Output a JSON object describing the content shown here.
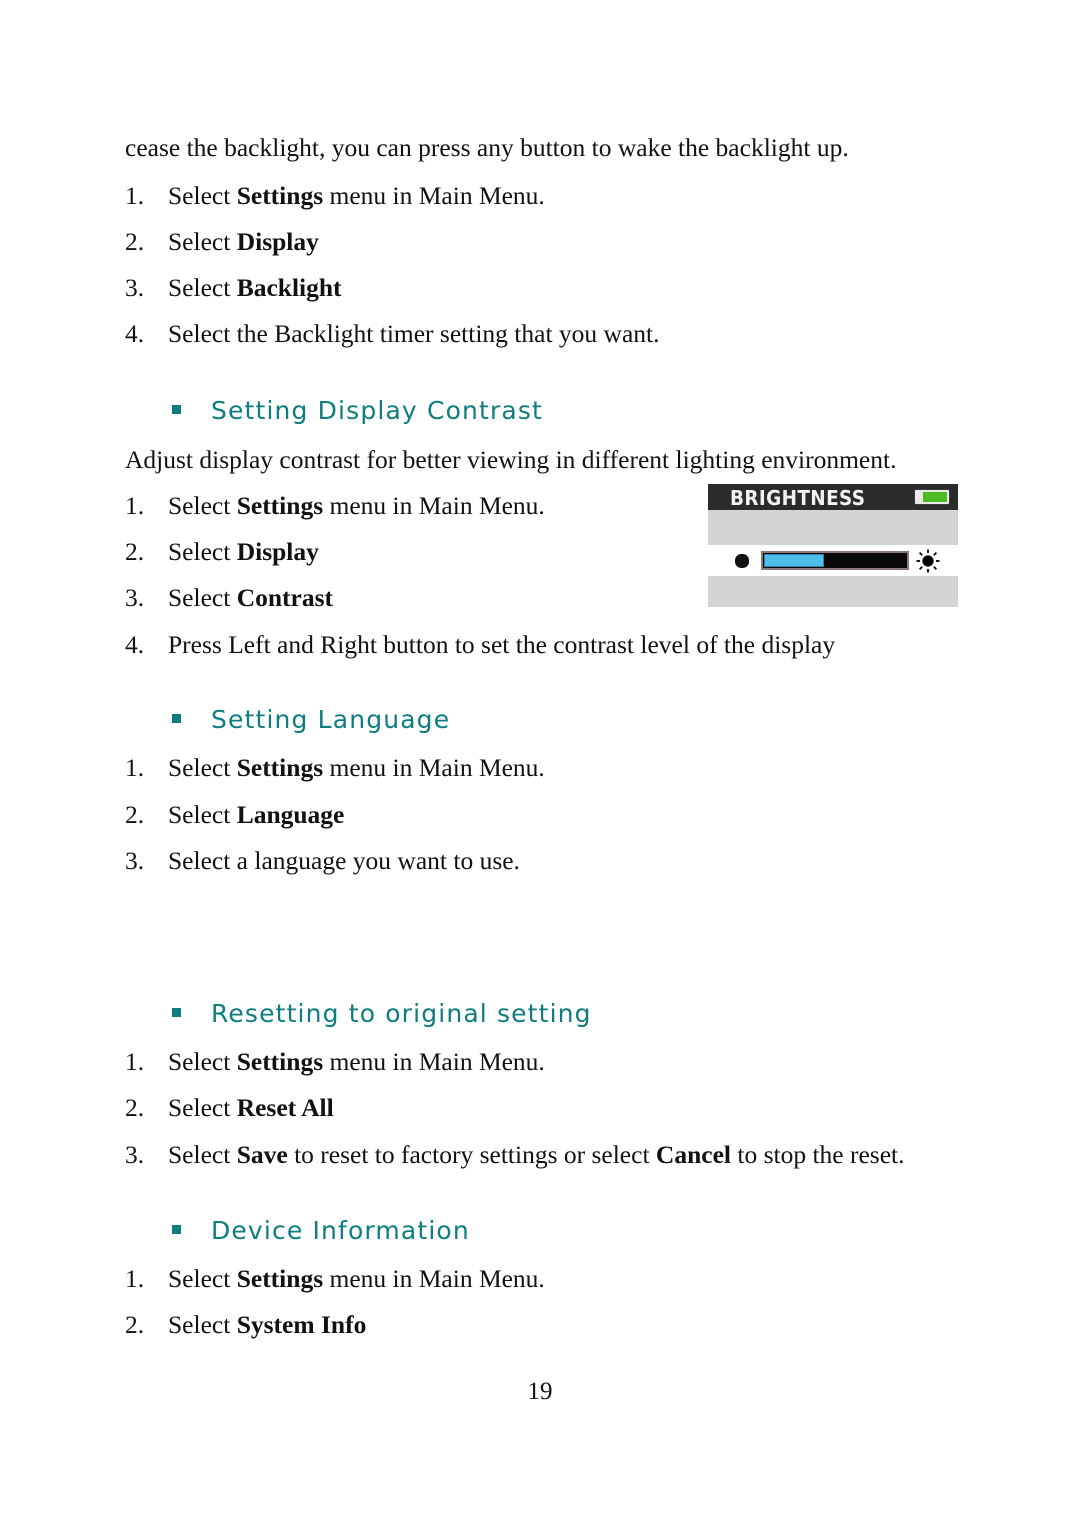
{
  "document": {
    "page_number": "19",
    "intro_line": "cease the backlight, you can press any button to wake the backlight up."
  },
  "theme": {
    "heading_color": "#0d7d7f",
    "body_color": "#111111",
    "device_titlebar_bg": "#2b2b2b",
    "device_body_bg": "#d4d4d4",
    "battery_fill": "#4cbb21",
    "contrast_fill": "#4ebfe8"
  },
  "sections": [
    {
      "id": "backlight-steps",
      "heading": null,
      "steps": [
        {
          "num": "1.",
          "pre": "Select ",
          "bold": "Settings",
          "post": " menu in Main Menu."
        },
        {
          "num": "2.",
          "pre": "Select ",
          "bold": "Display",
          "post": ""
        },
        {
          "num": "3.",
          "pre": "Select ",
          "bold": "Backlight",
          "post": ""
        },
        {
          "num": "4.",
          "pre": "Select the Backlight timer setting that you want.",
          "bold": "",
          "post": ""
        }
      ]
    },
    {
      "id": "setting-display-contrast",
      "heading": "Setting Display Contrast",
      "intro": "Adjust display contrast for better viewing in different lighting environment.",
      "steps": [
        {
          "num": "1.",
          "pre": "Select ",
          "bold": "Settings",
          "post": " menu in Main Menu."
        },
        {
          "num": "2.",
          "pre": "Select ",
          "bold": "Display",
          "post": ""
        },
        {
          "num": "3.",
          "pre": "Select ",
          "bold": "Contrast",
          "post": ""
        },
        {
          "num": "4.",
          "pre": "Press Left and Right button to set the contrast level of the display",
          "bold": "",
          "post": ""
        }
      ]
    },
    {
      "id": "setting-language",
      "heading": "Setting Language",
      "steps": [
        {
          "num": "1.",
          "pre": "Select ",
          "bold": "Settings",
          "post": " menu in Main Menu."
        },
        {
          "num": "2.",
          "pre": "Select ",
          "bold": "Language",
          "post": ""
        },
        {
          "num": "3.",
          "pre": "Select a language you want to use.",
          "bold": "",
          "post": ""
        }
      ]
    },
    {
      "id": "resetting-to-original-setting",
      "heading": "Resetting to original setting",
      "steps": [
        {
          "num": "1.",
          "pre": "Select ",
          "bold": "Settings",
          "post": " menu in Main Menu."
        },
        {
          "num": "2.",
          "pre": "Select ",
          "bold": "Reset All",
          "post": ""
        },
        {
          "num": "3.",
          "pre": "Select ",
          "bold": "Save",
          "post": " to reset to factory settings or select ",
          "bold2": "Cancel",
          "post2": " to stop the reset."
        }
      ]
    },
    {
      "id": "device-information",
      "heading": "Device Information",
      "steps": [
        {
          "num": "1.",
          "pre": "Select ",
          "bold": "Settings",
          "post": " menu in Main Menu."
        },
        {
          "num": "2.",
          "pre": "Select ",
          "bold": "System Info",
          "post": ""
        }
      ]
    }
  ],
  "device_screen": {
    "title": "BRIGHTNESS",
    "battery_level_percent": "70",
    "contrast_level_percent": "42",
    "icons": {
      "battery": "battery-icon",
      "sun": "brightness-sun-icon",
      "cursor": "selection-dot-icon"
    }
  }
}
